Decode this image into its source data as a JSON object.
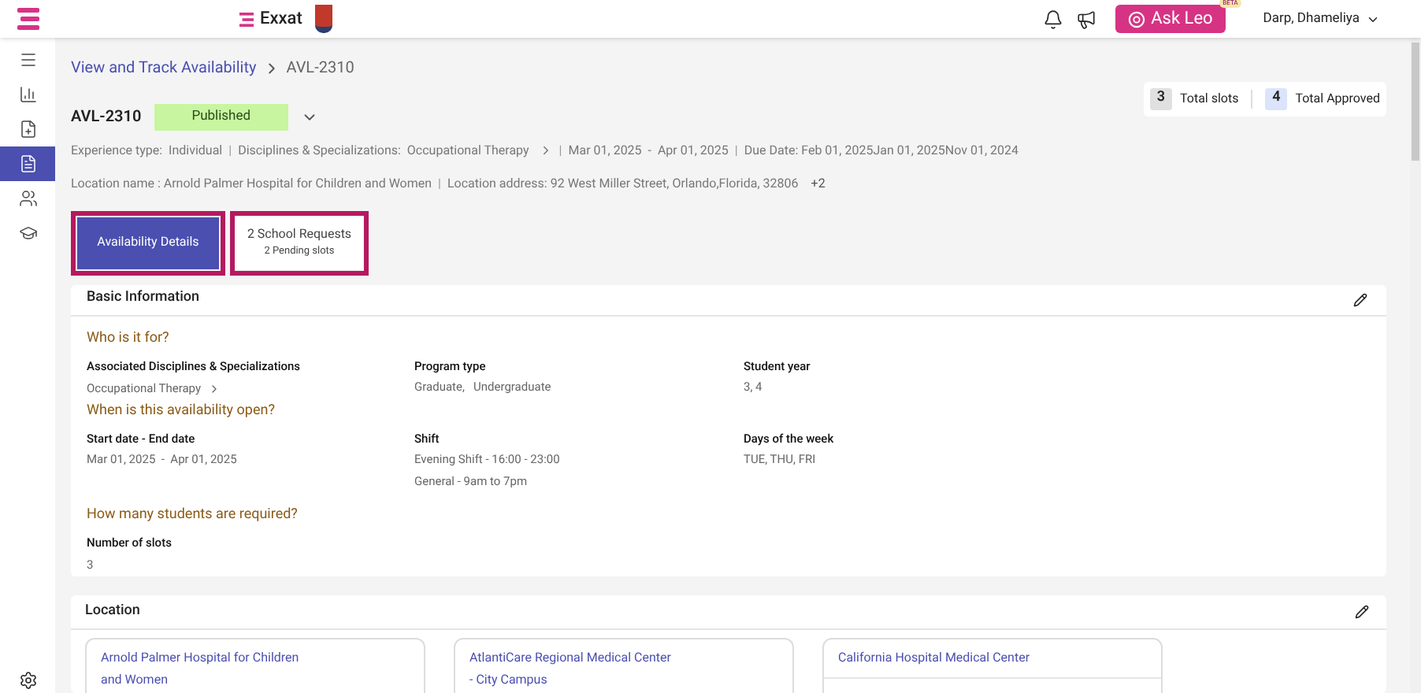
{
  "topbar": {
    "brand": "Exxat",
    "ask_button": "Ask Leo",
    "beta_badge": "BETA",
    "user": "Darp, Dhameliya"
  },
  "sidebar": {
    "items": [
      {
        "kind": "menu",
        "selected": false
      },
      {
        "kind": "chart",
        "selected": false
      },
      {
        "kind": "file-plus",
        "selected": false
      },
      {
        "kind": "file",
        "selected": true
      },
      {
        "kind": "users",
        "selected": false
      },
      {
        "kind": "cap",
        "selected": false
      }
    ]
  },
  "breadcrumb": {
    "parent": "View and Track Availability",
    "current": "AVL-2310"
  },
  "header": {
    "id": "AVL-2310",
    "status": "Published",
    "meta_1": [
      {
        "kind": "text",
        "text": "Experience type:  Individual"
      },
      {
        "kind": "separator",
        "text": "|"
      },
      {
        "kind": "text",
        "text": "Disciplines & Specializations:  Occupational Therapy"
      },
      {
        "kind": "chevron"
      },
      {
        "kind": "separator",
        "text": "|"
      },
      {
        "kind": "text",
        "text": "Mar 01, 2025  -  Apr 01, 2025"
      },
      {
        "kind": "separator",
        "text": "|"
      },
      {
        "kind": "text",
        "text": "Due Date: Feb 01, 2025Jan 01, 2025Nov 01, 2024"
      }
    ],
    "meta_2": [
      {
        "kind": "text",
        "text": "Location name : Arnold Palmer Hospital for Children and Women"
      },
      {
        "kind": "separator",
        "text": "|"
      },
      {
        "kind": "text",
        "text": "Location address: 92 West Miller Street, Orlando,Florida, 32806"
      }
    ],
    "more": "+2"
  },
  "stats": [
    {
      "count": "3",
      "label": "Total slots",
      "color": "#e0e0e0"
    },
    {
      "count": "4",
      "label": "Total Approved",
      "color": "#dbe4fb"
    }
  ],
  "tabs": [
    {
      "label": "Availability Details",
      "selected": true
    },
    {
      "label": "2 School Requests",
      "sublabel": "2 Pending slots",
      "selected": false
    }
  ],
  "basic_info": {
    "title": "Basic Information",
    "sections": [
      {
        "heading": "Who is it for?",
        "fields": [
          {
            "label": "Associated Disciplines & Specializations",
            "values": [
              "Occupational Therapy"
            ],
            "link": true
          },
          {
            "label": "Program type",
            "values": [
              "Graduate,   Undergraduate"
            ],
            "link": false
          },
          {
            "label": "Student year",
            "values": [
              "3, 4"
            ],
            "link": false
          }
        ]
      },
      {
        "heading": "When is this availability open?",
        "fields": [
          {
            "label": "Start date - End date",
            "values": [
              "Mar 01, 2025  -  Apr 01, 2025"
            ],
            "link": false
          },
          {
            "label": "Shift",
            "values": [
              "Evening Shift - 16:00 - 23:00",
              "General - 9am to 7pm"
            ],
            "link": false
          },
          {
            "label": "Days of the week",
            "values": [
              "TUE, THU, FRI"
            ],
            "link": false
          }
        ]
      },
      {
        "heading": "How many students are required?",
        "fields": [
          {
            "label": "Number of slots",
            "values": [
              "3"
            ],
            "link": false
          }
        ]
      }
    ]
  },
  "location": {
    "title": "Location",
    "cards": [
      "Arnold Palmer Hospital for Children and Women",
      "AtlantiCare Regional Medical Center - City Campus",
      "California Hospital Medical Center"
    ]
  }
}
